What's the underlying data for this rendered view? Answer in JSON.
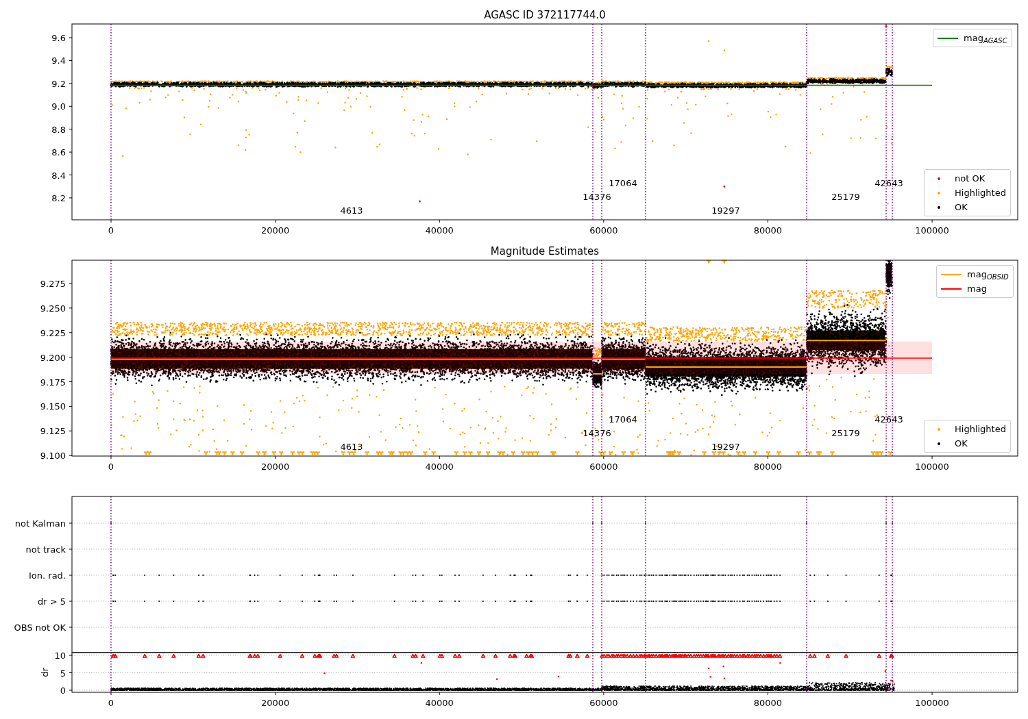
{
  "figure": {
    "panels": [
      {
        "chart_data": {
          "type": "line",
          "title": "AGASC ID 372117744.0",
          "xlim": [
            -4758,
            110430
          ],
          "ylim": [
            8.008,
            9.72
          ],
          "xticks": [
            0,
            20000,
            40000,
            60000,
            80000,
            100000
          ],
          "yticks": [
            {
              "value": 8.2,
              "label": "8.2"
            },
            {
              "value": 8.4,
              "label": "8.4"
            },
            {
              "value": 8.6,
              "label": "8.6"
            },
            {
              "value": 8.8,
              "label": "8.8"
            },
            {
              "value": 9.0,
              "label": "9.0"
            },
            {
              "value": 9.2,
              "label": "9.2"
            },
            {
              "value": 9.4,
              "label": "9.4"
            },
            {
              "value": 9.6,
              "label": "9.6"
            }
          ],
          "x": [
            0,
            100000
          ],
          "series": [
            {
              "name": "mag$_{AGASC}$",
              "color": "#008000",
              "values": [
                9.185,
                9.185
              ]
            }
          ],
          "ref_lines": [
            {
              "axis": "x",
              "value": 0,
              "color": "#800080"
            },
            {
              "axis": "x",
              "value": 58681,
              "color": "#800080"
            },
            {
              "axis": "x",
              "value": 59766,
              "color": "#800080"
            },
            {
              "axis": "x",
              "value": 65109,
              "color": "#800080"
            },
            {
              "axis": "x",
              "value": 84725,
              "color": "#800080"
            },
            {
              "axis": "x",
              "value": 94407,
              "color": "#800080"
            },
            {
              "axis": "x",
              "value": 95159,
              "color": "#800080"
            }
          ],
          "annotations": [
            "4613",
            "14376",
            "17064",
            "19297",
            "25179",
            "42643"
          ]
        },
        "point_legend": [
          {
            "label": "not OK",
            "color": "#ff0000"
          },
          {
            "label": "Highlighted",
            "color": "#ffa500"
          },
          {
            "label": "OK",
            "color": "#000000"
          }
        ]
      },
      {
        "chart_data": {
          "type": "line",
          "title": "Magnitude Estimates",
          "xlim": [
            -4758,
            110430
          ],
          "ylim": [
            9.0994,
            9.2987
          ],
          "xticks": [
            0,
            20000,
            40000,
            60000,
            80000,
            100000
          ],
          "yticks": [
            {
              "value": 9.1,
              "label": "9.100"
            },
            {
              "value": 9.125,
              "label": "9.125"
            },
            {
              "value": 9.15,
              "label": "9.150"
            },
            {
              "value": 9.175,
              "label": "9.175"
            },
            {
              "value": 9.2,
              "label": "9.200"
            },
            {
              "value": 9.225,
              "label": "9.225"
            },
            {
              "value": 9.25,
              "label": "9.250"
            },
            {
              "value": 9.275,
              "label": "9.275"
            }
          ],
          "x": [
            0,
            58681,
            58682,
            58683,
            59766,
            59767,
            59768,
            65109,
            65110,
            65111,
            84725,
            84726,
            84727,
            94407,
            100000
          ],
          "series": [
            {
              "name": "mag$_{OBSID}$",
              "color": "#ffa500",
              "values": [
                9.198,
                9.198,
                null,
                9.183,
                9.183,
                null,
                9.198,
                9.198,
                null,
                9.19,
                9.19,
                null,
                9.217,
                9.217,
                null
              ]
            },
            {
              "name": "mag",
              "color": "#ff0000",
              "values": [
                9.199,
                9.199,
                9.199,
                9.199,
                9.199,
                9.199,
                9.199,
                9.199,
                9.199,
                9.199,
                9.199,
                9.199,
                9.199,
                9.199,
                9.199
              ]
            }
          ],
          "bands": [
            {
              "axis": "y",
              "from": 9.183,
              "to": 9.216,
              "color": "#ff0000"
            }
          ],
          "ref_lines": [
            {
              "axis": "x",
              "value": 0,
              "color": "#800080"
            },
            {
              "axis": "x",
              "value": 58681,
              "color": "#800080"
            },
            {
              "axis": "x",
              "value": 59766,
              "color": "#800080"
            },
            {
              "axis": "x",
              "value": 65109,
              "color": "#800080"
            },
            {
              "axis": "x",
              "value": 84725,
              "color": "#800080"
            },
            {
              "axis": "x",
              "value": 94407,
              "color": "#800080"
            },
            {
              "axis": "x",
              "value": 95159,
              "color": "#800080"
            }
          ],
          "annotations": [
            "4613",
            "14376",
            "17064",
            "19297",
            "25179",
            "42643"
          ]
        },
        "point_legend": [
          {
            "label": "Highlighted",
            "color": "#ffa500"
          },
          {
            "label": "OK",
            "color": "#000000"
          }
        ]
      },
      {
        "row_labels": [
          "not Kalman",
          "not track",
          "Ion. rad.",
          "dr > 5",
          "OBS not OK"
        ]
      },
      {
        "ylabel": "dr",
        "ytick_labels": [
          "10",
          "5",
          "0"
        ],
        "xtick_labels": [
          "0",
          "20000",
          "40000",
          "60000",
          "80000",
          "100000"
        ]
      }
    ]
  }
}
